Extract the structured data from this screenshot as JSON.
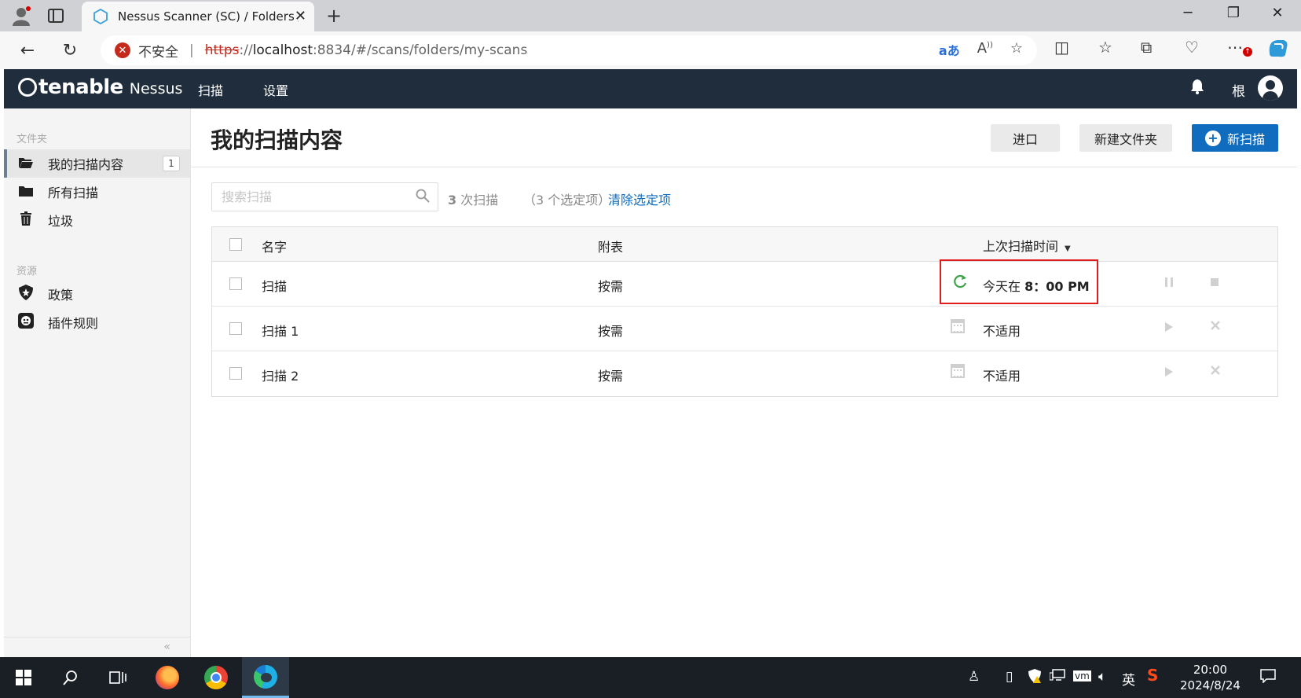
{
  "browser": {
    "tab_title": "Nessus Scanner (SC) / Folders / M",
    "security_label": "不安全",
    "url_protocol": "https",
    "url_separator": "://",
    "url_host": "localhost",
    "url_rest": ":8834/#/scans/folders/my-scans"
  },
  "app": {
    "brand": "tenable",
    "product": "Nessus",
    "nav": [
      "扫描",
      "设置"
    ],
    "user_name": "根"
  },
  "sidebar": {
    "folders_heading": "文件夹",
    "folders": [
      {
        "label": "我的扫描内容",
        "badge": "1",
        "icon": "folder-open-icon"
      },
      {
        "label": "所有扫描",
        "icon": "folder-icon"
      },
      {
        "label": "垃圾",
        "icon": "trash-icon"
      }
    ],
    "resources_heading": "资源",
    "resources": [
      {
        "label": "政策",
        "icon": "policy-shield-icon"
      },
      {
        "label": "插件规则",
        "icon": "plugin-rules-icon"
      }
    ],
    "collapse_label": "«"
  },
  "main": {
    "title": "我的扫描内容",
    "import_label": "进口",
    "new_folder_label": "新建文件夹",
    "new_scan_label": "新扫描",
    "search_placeholder": "搜索扫描",
    "scan_count_num": "3",
    "scan_count_text": " 次扫描",
    "selected_text": "（3 个选定项）",
    "clear_selection": "清除选定项",
    "table": {
      "headers": {
        "name": "名字",
        "schedule": "附表",
        "last_modified": "上次扫描时间"
      },
      "rows": [
        {
          "name": "扫描",
          "schedule": "按需",
          "status_icon": "running-refresh-icon",
          "last_prefix": "今天在 ",
          "last_bold": "8：00 PM",
          "actions": [
            "pause-icon",
            "stop-icon"
          ]
        },
        {
          "name": "扫描 1",
          "schedule": "按需",
          "status_icon": "calendar-icon",
          "last_prefix": "不适用",
          "last_bold": "",
          "actions": [
            "play-icon",
            "delete-icon"
          ]
        },
        {
          "name": "扫描 2",
          "schedule": "按需",
          "status_icon": "calendar-icon",
          "last_prefix": "不适用",
          "last_bold": "",
          "actions": [
            "play-icon",
            "delete-icon"
          ]
        }
      ]
    }
  },
  "taskbar": {
    "ime_label": "英",
    "time": "20:00",
    "date": "2024/8/24"
  },
  "colors": {
    "nessus_header": "#1f2d3d",
    "primary_blue": "#0f6cbf",
    "running_green": "#3ea34a",
    "highlight_red": "#e01d1d"
  }
}
